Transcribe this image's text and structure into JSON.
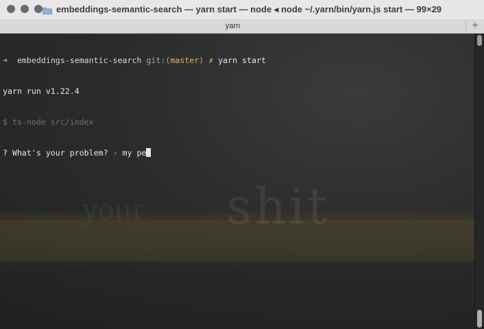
{
  "window": {
    "title": "embeddings-semantic-search — yarn start — node ◂ node ~/.yarn/bin/yarn.js start — 99×29",
    "folder_icon": "folder-icon"
  },
  "tabs": [
    {
      "label": "yarn"
    }
  ],
  "new_tab_label": "+",
  "terminal": {
    "prompt_arrow": "➜",
    "prompt_dir": "embeddings-semantic-search",
    "prompt_git": "git:(",
    "prompt_branch": "master",
    "prompt_git_close": ")",
    "prompt_dirty": "✗",
    "command": "yarn start",
    "line2": "yarn run v1.22.4",
    "line3": "$ ts-node src/index",
    "question_mark": "?",
    "question": "What's your problem?",
    "separator": "›",
    "input_value": "my pe"
  },
  "background_text": {
    "large": "shit",
    "small": "your"
  },
  "colors": {
    "titlebar": "#e8e6e8",
    "terminal_bg": "#2a2b2b",
    "branch": "#e8b060",
    "prompt_arrow": "#8fd19e"
  }
}
